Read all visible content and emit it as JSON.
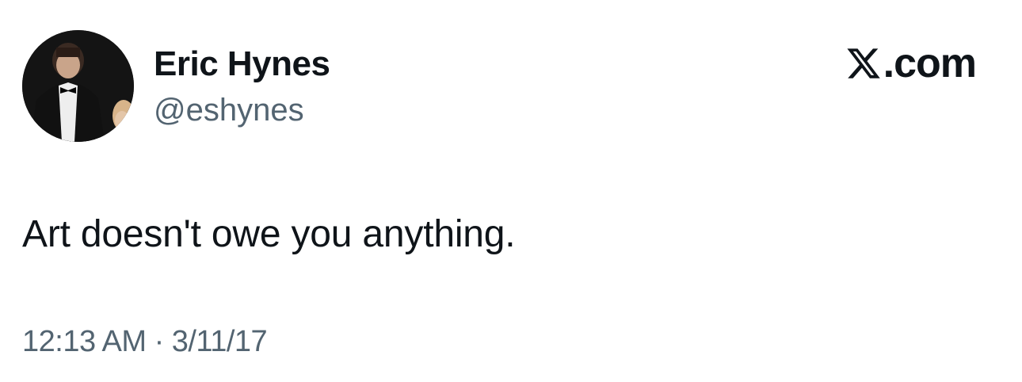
{
  "author": {
    "display_name": "Eric Hynes",
    "handle": "@eshynes",
    "avatar": "profile-photo"
  },
  "brand": {
    "logo_icon": "x-logo-icon",
    "text": ".com"
  },
  "tweet": {
    "text": "Art doesn't owe you anything."
  },
  "meta": {
    "time": "12:13 AM",
    "separator": "·",
    "date": "3/11/17"
  },
  "colors": {
    "text_primary": "#0f1419",
    "text_secondary": "#536471",
    "background": "#ffffff"
  }
}
